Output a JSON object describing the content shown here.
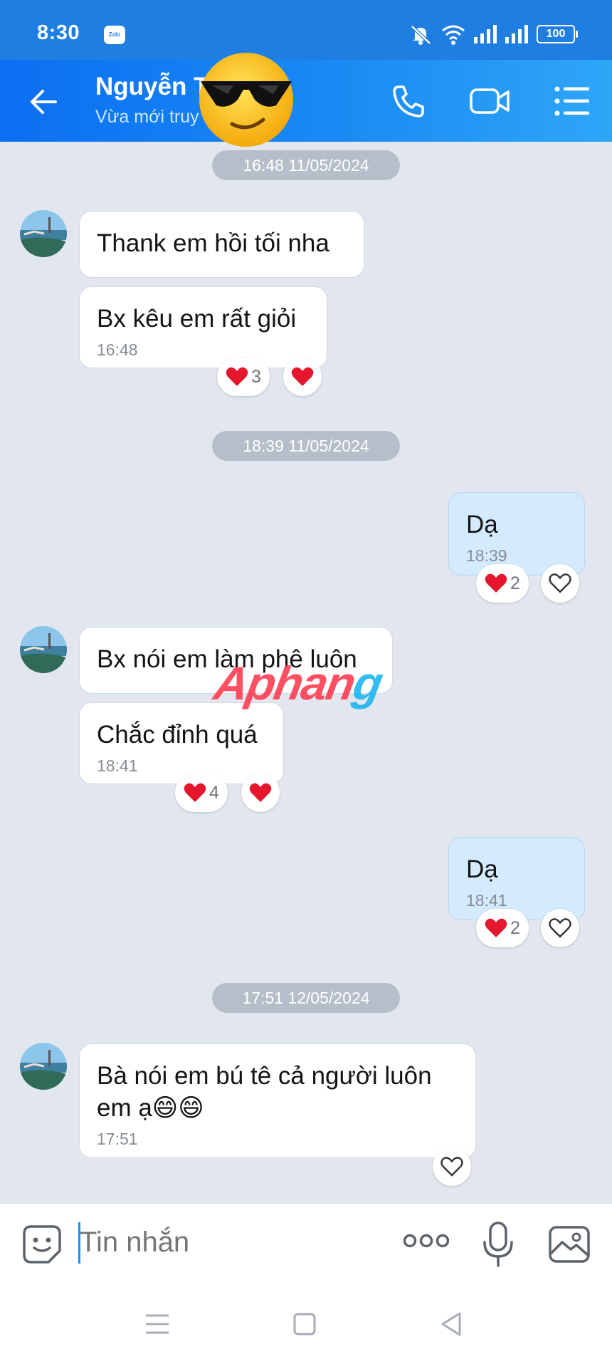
{
  "status_bar": {
    "time": "8:30",
    "app_badge": "Zalo",
    "battery": "100"
  },
  "header": {
    "contact_name": "Nguyễn T... Hà",
    "contact_status": "Vừa mới truy cập"
  },
  "messages": {
    "date1": "16:48 11/05/2024",
    "m1": {
      "text": "Thank em hồi tối nha"
    },
    "m2": {
      "text": "Bx kêu em rất giỏi",
      "time": "16:48",
      "reaction_count": "3"
    },
    "date2": "18:39 11/05/2024",
    "m3": {
      "text": "Dạ",
      "time": "18:39",
      "reaction_count": "2"
    },
    "m4": {
      "text": "Bx nói em làm phê luôn"
    },
    "m5": {
      "text": "Chắc đỉnh quá",
      "time": "18:41",
      "reaction_count": "4"
    },
    "m6": {
      "text": "Dạ",
      "time": "18:41",
      "reaction_count": "2"
    },
    "date3": "17:51 12/05/2024",
    "m7": {
      "text": "Bà nói em bú tê cả người luôn em ạ😄😄",
      "time": "17:51"
    }
  },
  "watermark": {
    "left": "Aphan",
    "right": "g"
  },
  "input": {
    "placeholder": "Tin nhắn"
  }
}
